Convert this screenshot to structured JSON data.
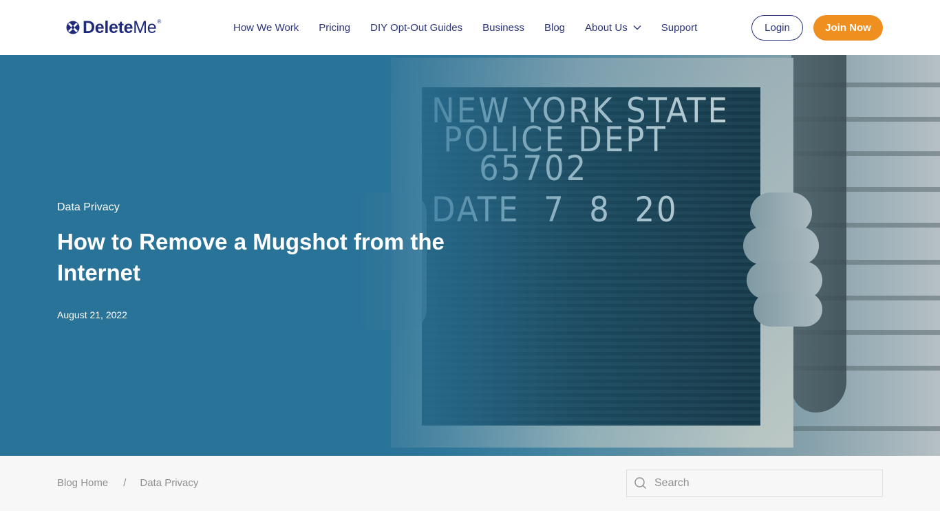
{
  "brand": {
    "name_bold": "Delete",
    "name_light": "Me",
    "registered": "®",
    "color_primary": "#1f2a7a",
    "color_accent": "#ef8f1f",
    "color_hero": "#2a7398"
  },
  "nav": {
    "items": [
      {
        "label": "How We Work"
      },
      {
        "label": "Pricing"
      },
      {
        "label": "DIY Opt-Out Guides"
      },
      {
        "label": "Business"
      },
      {
        "label": "Blog"
      },
      {
        "label": "About Us",
        "has_dropdown": true
      },
      {
        "label": "Support"
      }
    ],
    "login_label": "Login",
    "join_label": "Join Now"
  },
  "hero": {
    "category": "Data Privacy",
    "title": "How to Remove a Mugshot from the Internet",
    "date": "August 21, 2022",
    "image_sign_lines": [
      "NEW YORK STATE",
      " POLICE DEPT",
      "    65702",
      "DATE  7  8  20"
    ]
  },
  "breadcrumb": {
    "items": [
      {
        "label": "Blog Home"
      },
      {
        "label": "Data Privacy"
      }
    ],
    "separator": "/"
  },
  "search": {
    "placeholder": "Search",
    "value": ""
  }
}
